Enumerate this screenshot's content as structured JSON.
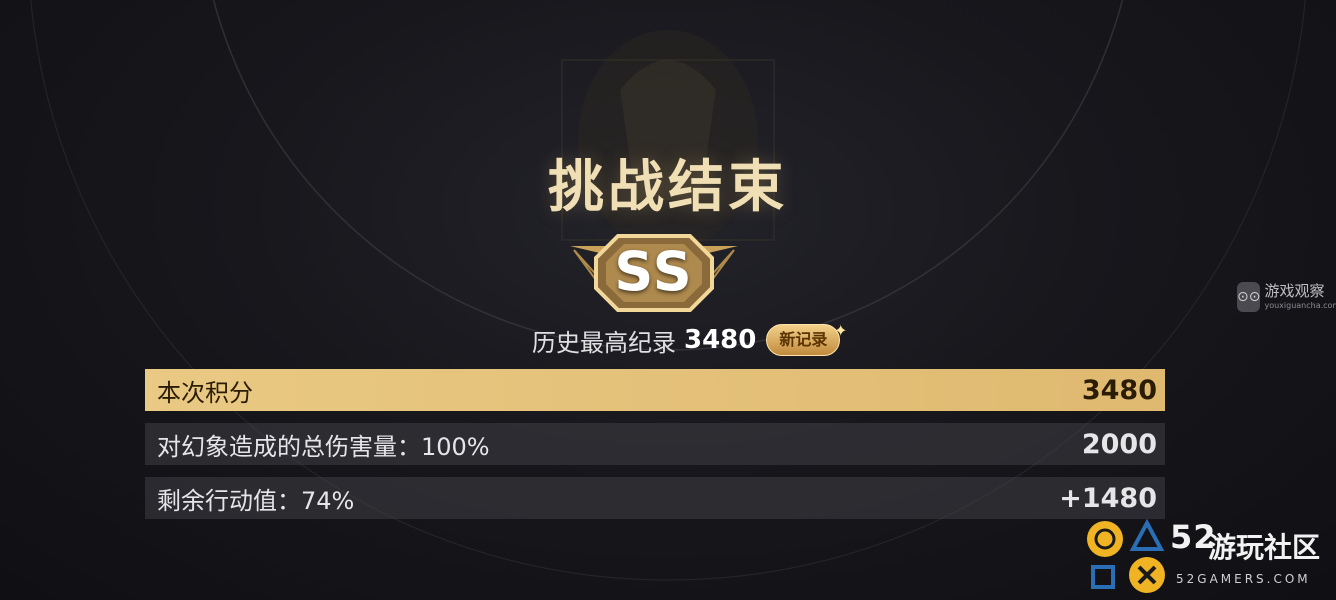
{
  "title": "挑战结束",
  "grade": "SS",
  "record": {
    "label": "历史最高纪录",
    "value": "3480",
    "new_tag": "新记录"
  },
  "score_rows": [
    {
      "label": "本次积分",
      "value": "3480"
    },
    {
      "label": "对幻象造成的总伤害量：100%",
      "value": "2000"
    },
    {
      "label": "剩余行动值：74%",
      "value": "+1480"
    }
  ],
  "side_logo": {
    "title": "游戏观察",
    "url": "youxiguancha.com"
  },
  "watermark": {
    "number": "52",
    "name": "游玩社区",
    "domain": "52GAMERS.COM"
  },
  "colors": {
    "gold_row": "#e9c983",
    "title_gold": "#f0dfb4",
    "dark_row": "#3a3a42"
  }
}
